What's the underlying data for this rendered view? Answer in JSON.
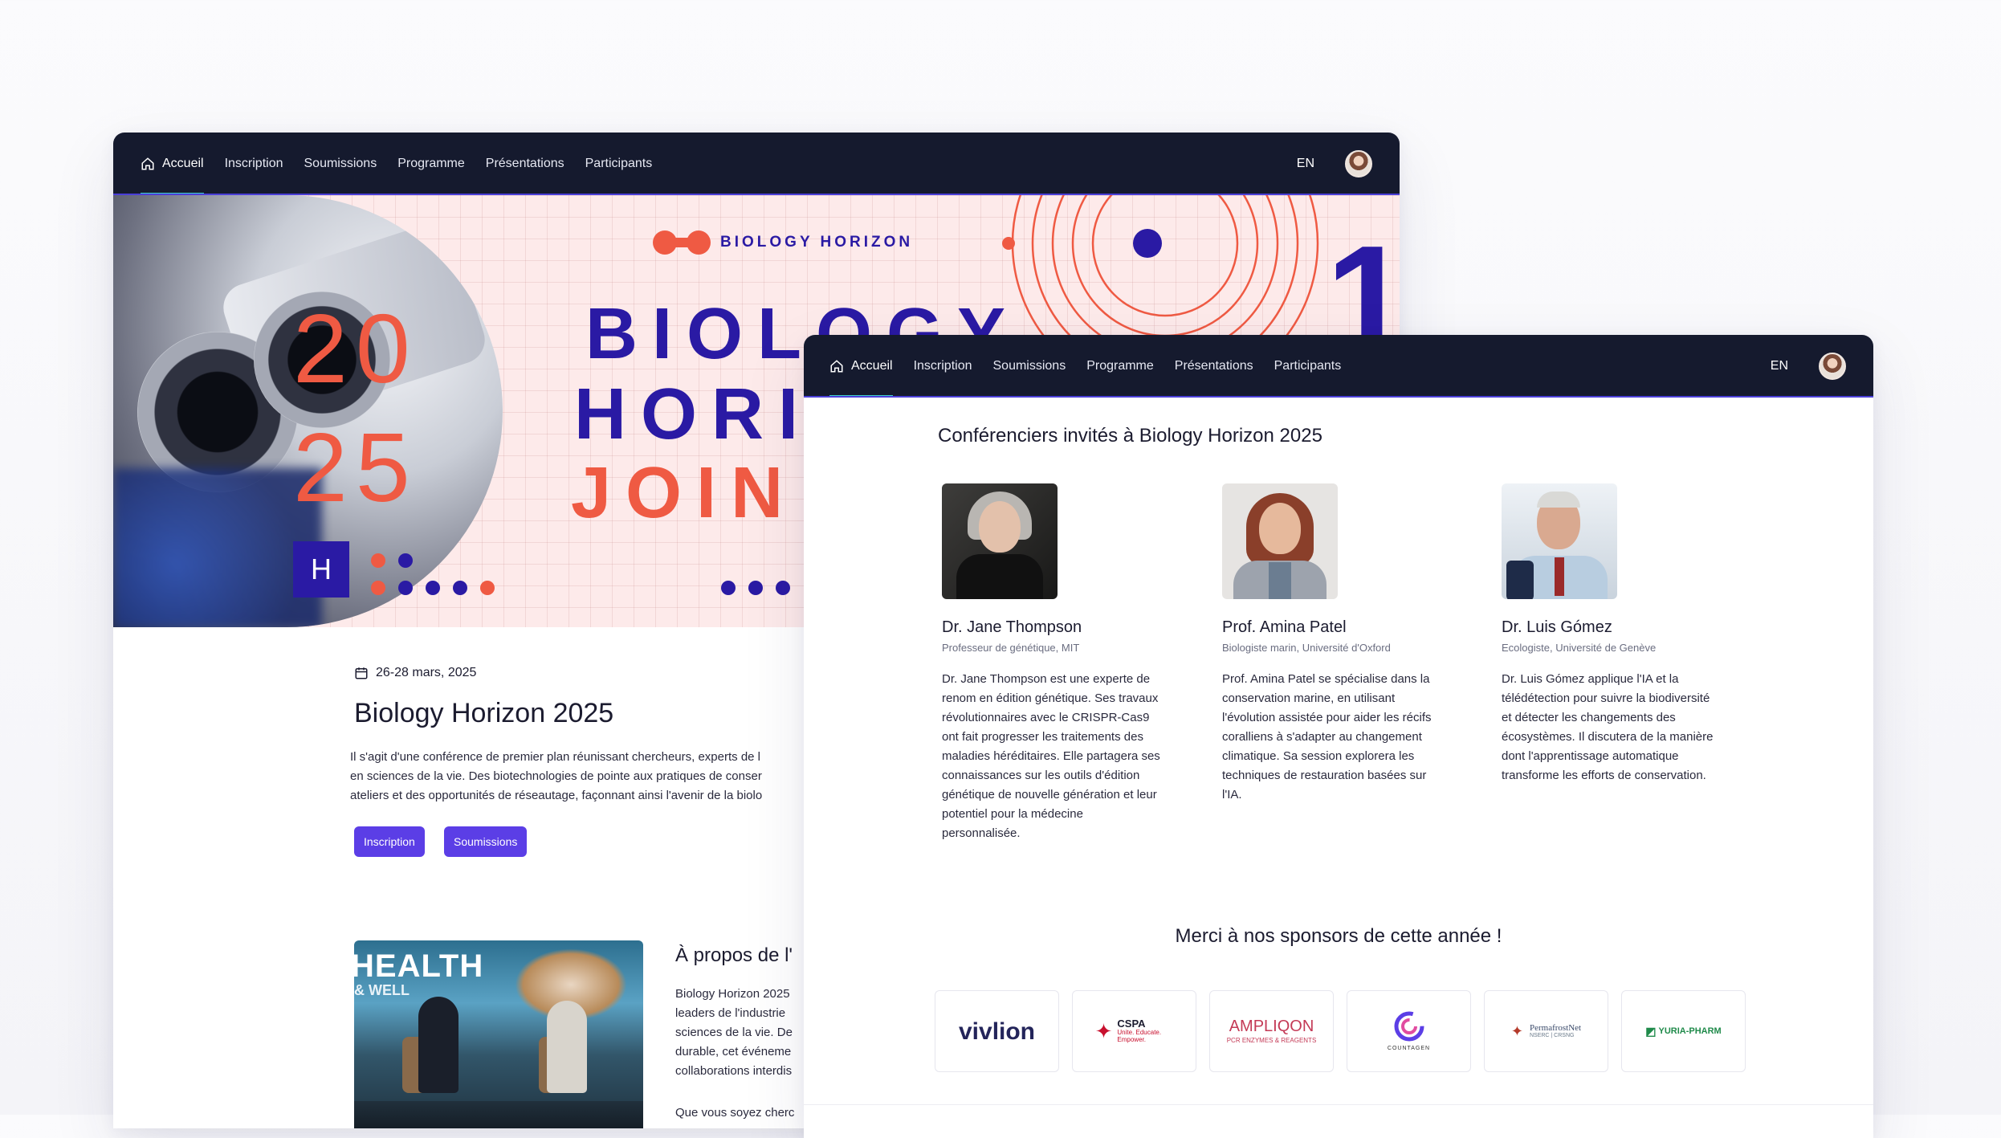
{
  "nav": {
    "items": [
      "Accueil",
      "Inscription",
      "Soumissions",
      "Programme",
      "Présentations",
      "Participants"
    ],
    "lang": "EN"
  },
  "hero": {
    "logo_text": "BIOLOGY HORIZON",
    "year_top": "20",
    "year_bottom": "25",
    "badge_letter": "H",
    "line1": "BIOLOGY",
    "line2": "HORIZ",
    "line3": "JOIN U",
    "big_digit": "1",
    "colors": {
      "navy": "#2a1aa4",
      "coral": "#ef5a43",
      "bg": "#fdeaea"
    }
  },
  "event": {
    "date": "26-28 mars, 2025",
    "title": "Biology Horizon 2025",
    "description_lines": [
      "Il s'agit d'une conférence de premier plan réunissant chercheurs, experts de l",
      "en sciences de la vie. Des biotechnologies de pointe aux pratiques de conser",
      "ateliers et des opportunités de réseautage, façonnant ainsi l'avenir de la biolo"
    ],
    "btn_inscription": "Inscription",
    "btn_soumissions": "Soumissions"
  },
  "photo": {
    "sign_line1": "HEALTH",
    "sign_line2": "& WELL"
  },
  "about": {
    "title": "À propos de l'",
    "lines": [
      "Biology Horizon 2025",
      "leaders de l'industrie",
      "sciences de la vie. De",
      "durable, cet événeme",
      "collaborations interdis"
    ],
    "more": "Que vous soyez cherc"
  },
  "speakers_section": {
    "title": "Conférenciers invités à Biology Horizon 2025",
    "speakers": [
      {
        "name": "Dr. Jane Thompson",
        "role": "Professeur de génétique, MIT",
        "bio": [
          "Dr. Jane Thompson est une experte de",
          "renom en édition génétique. Ses travaux",
          "révolutionnaires avec le CRISPR-Cas9",
          "ont fait progresser les traitements des",
          "maladies héréditaires. Elle partagera ses",
          "connaissances sur les outils d'édition",
          "génétique de nouvelle génération et leur",
          "potentiel pour la médecine",
          "personnalisée."
        ]
      },
      {
        "name": "Prof. Amina Patel",
        "role": "Biologiste marin, Université d'Oxford",
        "bio": [
          "Prof. Amina Patel se spécialise dans la",
          "conservation marine, en utilisant",
          "l'évolution assistée pour aider les récifs",
          "coralliens à s'adapter au changement",
          "climatique. Sa session explorera les",
          "techniques de restauration basées sur",
          "l'IA."
        ]
      },
      {
        "name": "Dr. Luis Gómez",
        "role": "Ecologiste, Université de Genève",
        "bio": [
          "Dr. Luis Gómez applique l'IA et la",
          "télédétection pour suivre la biodiversité",
          "et détecter les changements des",
          "écosystèmes. Il discutera de la manière",
          "dont l'apprentissage automatique",
          "transforme les efforts de conservation."
        ]
      }
    ]
  },
  "sponsors": {
    "title": "Merci à nos sponsors de cette année !",
    "items": [
      {
        "name": "vivlion",
        "sub": ""
      },
      {
        "name": "CSPA",
        "sub": "Unite. Educate. Empower."
      },
      {
        "name": "AMPLIQON",
        "sub": "PCR ENZYMES & REAGENTS"
      },
      {
        "name": "COUNTAGEN",
        "sub": ""
      },
      {
        "name": "PermafrostNet",
        "sub": "NSERC | CRSNG"
      },
      {
        "name": "YURIA-PHARM",
        "sub": ""
      }
    ]
  }
}
